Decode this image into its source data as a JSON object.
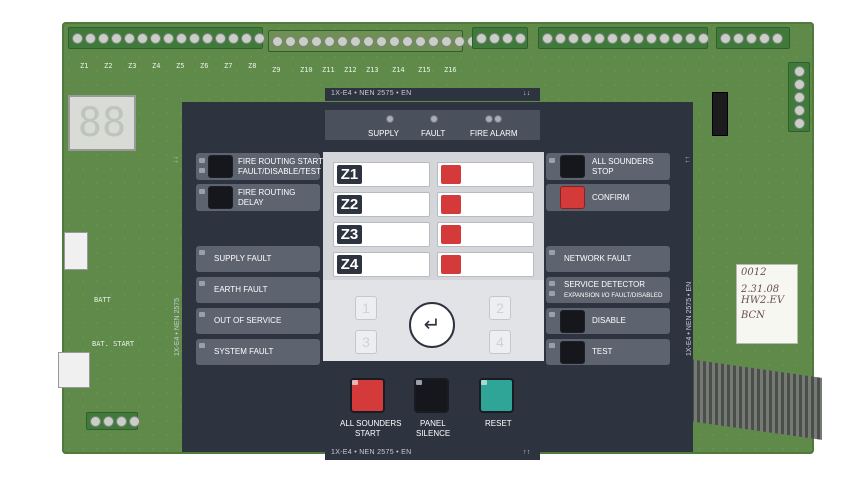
{
  "board": {
    "zone_terminal_labels": [
      "Z1",
      "Z2",
      "Z3",
      "Z4",
      "Z5",
      "Z6",
      "Z7",
      "Z8",
      "Z9",
      "Z10",
      "Z11",
      "Z12",
      "Z13",
      "Z14",
      "Z15",
      "Z16"
    ],
    "bat_label": "BATT",
    "bat_start_label": "BAT. START",
    "seg_display": "88",
    "sticker_lines": [
      "0012",
      "2.31.08",
      "HW2.EV",
      "BCN"
    ]
  },
  "panel": {
    "top_band_text": "1X-E4 • NEN 2575 • EN",
    "top_band_arrows": "↓↓",
    "bottom_band_text": "1X-E4 • NEN 2575 • EN",
    "bottom_band_arrows": "↑↑",
    "side_left_text": "1X-E4 • NEN 2575",
    "side_right_text": "1X-E4 • NEN 2575 • EN",
    "side_arrows_left": "↓↓",
    "side_arrows_right": "↑↑",
    "header": {
      "supply": "SUPPLY",
      "fault": "FAULT",
      "fire_alarm": "FIRE ALARM"
    },
    "left_buttons": {
      "fire_routing_start": "FIRE ROUTING START",
      "fire_routing_start_sub": "FAULT/DISABLE/TEST",
      "fire_routing_delay_1": "FIRE ROUTING",
      "fire_routing_delay_2": "DELAY",
      "supply_fault": "SUPPLY FAULT",
      "earth_fault": "EARTH FAULT",
      "out_of_service": "OUT OF SERVICE",
      "system_fault": "SYSTEM FAULT"
    },
    "right_buttons": {
      "all_sounders_stop_1": "ALL SOUNDERS",
      "all_sounders_stop_2": "STOP",
      "confirm": "CONFIRM",
      "network_fault": "NETWORK FAULT",
      "service_detector": "SERVICE DETECTOR",
      "service_detector_sub": "EXPANSION I/O FAULT/DISABLED",
      "disable": "DISABLE",
      "test": "TEST"
    },
    "zones": [
      "Z1",
      "Z2",
      "Z3",
      "Z4"
    ],
    "keypad": {
      "k1": "1",
      "k2": "2",
      "k3": "3",
      "k4": "4",
      "enter": "↵"
    },
    "bottom": {
      "all_sounders_start_1": "ALL SOUNDERS",
      "all_sounders_start_2": "START",
      "panel_silence_1": "PANEL",
      "panel_silence_2": "SILENCE",
      "reset": "RESET"
    }
  },
  "colors": {
    "panel": "#2e3340",
    "button": "#5d636f",
    "alarm_red": "#d43a3a",
    "reset_teal": "#2ea597",
    "pcb_green": "#5f8a4a"
  }
}
